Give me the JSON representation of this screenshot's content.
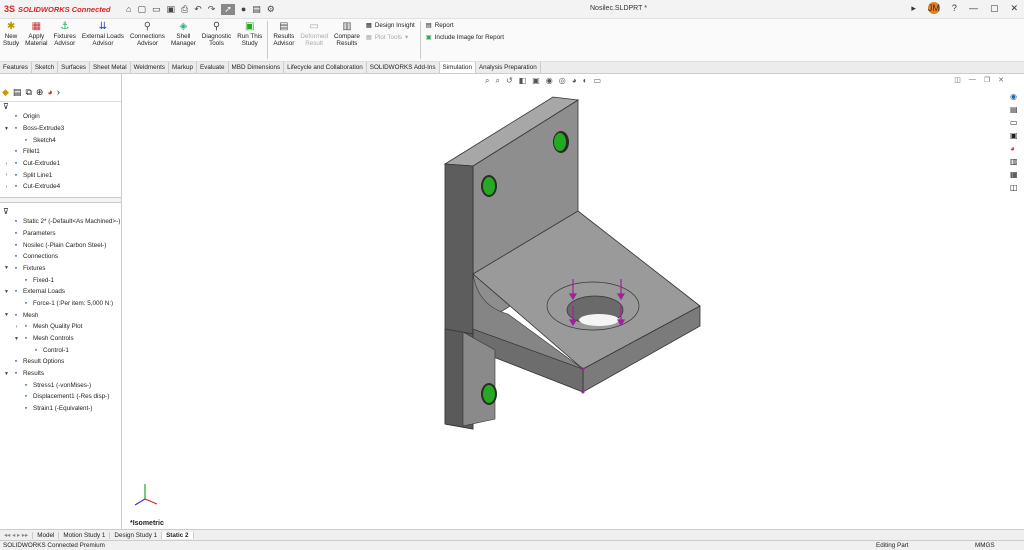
{
  "app": {
    "logo": "SOLIDWORKS Connected",
    "document_title": "Nosilec.SLDPRT *"
  },
  "window": {
    "user_initials": "JM"
  },
  "ribbon": {
    "buttons": [
      {
        "label": "New\nStudy",
        "icon": "new-study-icon",
        "enabled": true
      },
      {
        "label": "Apply\nMaterial",
        "icon": "apply-material-icon",
        "enabled": true
      },
      {
        "label": "Fixtures\nAdvisor",
        "icon": "fixtures-advisor-icon",
        "enabled": true
      },
      {
        "label": "External Loads\nAdvisor",
        "icon": "external-loads-icon",
        "enabled": true
      },
      {
        "label": "Connections\nAdvisor",
        "icon": "connections-advisor-icon",
        "enabled": true
      },
      {
        "label": "Shell\nManager",
        "icon": "shell-manager-icon",
        "enabled": true
      },
      {
        "label": "Diagnostic\nTools",
        "icon": "diagnostic-tools-icon",
        "enabled": true
      },
      {
        "label": "Run This\nStudy",
        "icon": "run-study-icon",
        "enabled": true
      },
      {
        "label": "Results\nAdvisor",
        "icon": "results-advisor-icon",
        "enabled": true
      },
      {
        "label": "Deformed\nResult",
        "icon": "deformed-result-icon",
        "enabled": false
      },
      {
        "label": "Compare\nResults",
        "icon": "compare-results-icon",
        "enabled": true
      }
    ],
    "design_insight": "Design Insight",
    "plot_tools": "Plot Tools",
    "report": "Report",
    "include_image": "Include Image for Report"
  },
  "command_tabs": [
    "Features",
    "Sketch",
    "Surfaces",
    "Sheet Metal",
    "Weldments",
    "Markup",
    "Evaluate",
    "MBD Dimensions",
    "Lifecycle and Collaboration",
    "SOLIDWORKS Add-Ins",
    "Simulation",
    "Analysis Preparation"
  ],
  "active_tab": "Simulation",
  "feature_tree": [
    {
      "label": "Origin",
      "expand": "",
      "icon": "origin-icon",
      "indent": 0
    },
    {
      "label": "Boss-Extrude3",
      "expand": "▼",
      "icon": "boss-extrude-icon",
      "indent": 0
    },
    {
      "label": "Sketch4",
      "expand": "",
      "icon": "sketch-icon",
      "indent": 1
    },
    {
      "label": "Fillet1",
      "expand": "",
      "icon": "fillet-icon",
      "indent": 0
    },
    {
      "label": "Cut-Extrude1",
      "expand": "›",
      "icon": "cut-extrude-icon",
      "indent": 0
    },
    {
      "label": "Split Line1",
      "expand": "›",
      "icon": "split-line-icon",
      "indent": 0
    },
    {
      "label": "Cut-Extrude4",
      "expand": "›",
      "icon": "cut-extrude-icon",
      "indent": 0
    }
  ],
  "sim_tree": [
    {
      "label": "Static 2* (-Default<As Machined>-)",
      "expand": "",
      "icon": "study-icon",
      "indent": 0
    },
    {
      "label": "Parameters",
      "expand": "",
      "icon": "parameters-icon",
      "indent": 0
    },
    {
      "label": "Nosilec (-Plain Carbon Steel-)",
      "expand": "",
      "icon": "part-icon",
      "indent": 0
    },
    {
      "label": "Connections",
      "expand": "",
      "icon": "connections-icon",
      "indent": 0
    },
    {
      "label": "Fixtures",
      "expand": "▼",
      "icon": "fixtures-icon",
      "indent": 0
    },
    {
      "label": "Fixed-1",
      "expand": "",
      "icon": "fixed-icon",
      "indent": 1
    },
    {
      "label": "External Loads",
      "expand": "▼",
      "icon": "external-loads-icon",
      "indent": 0
    },
    {
      "label": "Force-1 (:Per item: 5,000 N:)",
      "expand": "",
      "icon": "force-icon",
      "indent": 1
    },
    {
      "label": "Mesh",
      "expand": "▼",
      "icon": "mesh-icon",
      "indent": 0
    },
    {
      "label": "Mesh Quality Plot",
      "expand": "›",
      "icon": "mesh-quality-icon",
      "indent": 1
    },
    {
      "label": "Mesh Controls",
      "expand": "▼",
      "icon": "mesh-controls-icon",
      "indent": 1
    },
    {
      "label": "Control-1",
      "expand": "",
      "icon": "control-icon",
      "indent": 2
    },
    {
      "label": "Result Options",
      "expand": "",
      "icon": "result-options-icon",
      "indent": 0
    },
    {
      "label": "Results",
      "expand": "▼",
      "icon": "results-icon",
      "indent": 0
    },
    {
      "label": "Stress1 (-vonMises-)",
      "expand": "",
      "icon": "stress-icon",
      "indent": 1
    },
    {
      "label": "Displacement1 (-Res disp-)",
      "expand": "",
      "icon": "displacement-icon",
      "indent": 1
    },
    {
      "label": "Strain1 (-Equivalent-)",
      "expand": "",
      "icon": "strain-icon",
      "indent": 1
    }
  ],
  "viewport": {
    "view_label": "*Isometric"
  },
  "bottom_tabs": [
    "Model",
    "Motion Study 1",
    "Design Study 1",
    "Static 2"
  ],
  "active_bottom_tab": "Static 2",
  "status": {
    "product": "SOLIDWORKS Connected Premium",
    "mode": "Editing Part",
    "units": "MMGS"
  },
  "colors": {
    "accent": "#d22",
    "model": "#7a7a7a",
    "load_arrow": "#a020a0",
    "fixture": "#22aa22"
  }
}
